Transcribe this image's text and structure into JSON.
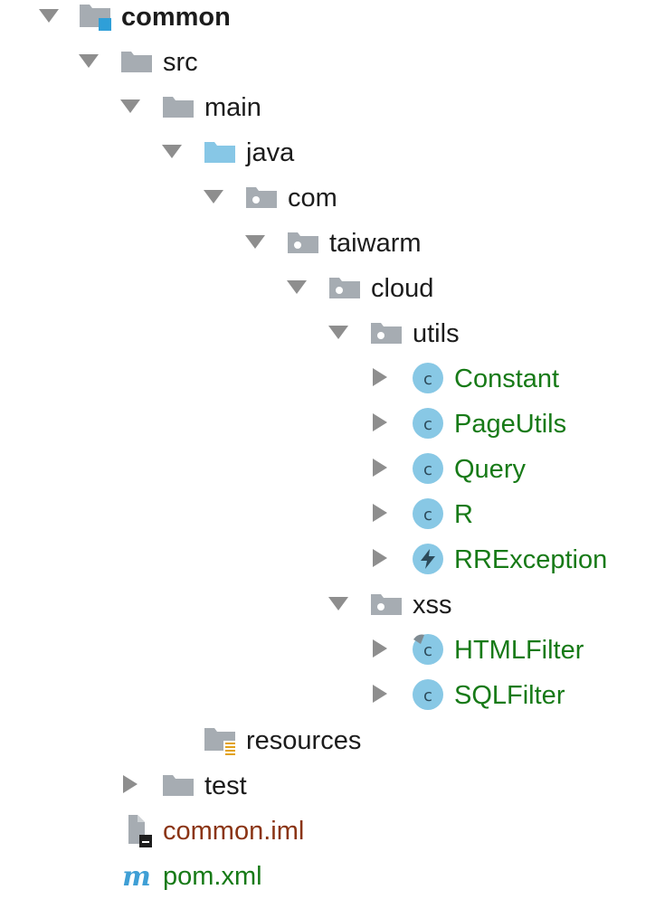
{
  "project_tree": {
    "root": {
      "label": "common",
      "icon": "module-folder-icon",
      "expanded": true
    },
    "nodes": [
      {
        "label": "src",
        "icon": "folder-icon",
        "expanded": true
      },
      {
        "label": "main",
        "icon": "folder-icon",
        "expanded": true
      },
      {
        "label": "java",
        "icon": "source-root-folder-icon",
        "expanded": true
      },
      {
        "label": "com",
        "icon": "package-icon",
        "expanded": true
      },
      {
        "label": "taiwarm",
        "icon": "package-icon",
        "expanded": true
      },
      {
        "label": "cloud",
        "icon": "package-icon",
        "expanded": true
      },
      {
        "label": "utils",
        "icon": "package-icon",
        "expanded": true
      },
      {
        "label": "Constant",
        "icon": "class-icon",
        "expanded": false
      },
      {
        "label": "PageUtils",
        "icon": "class-icon",
        "expanded": false
      },
      {
        "label": "Query",
        "icon": "class-icon",
        "expanded": false
      },
      {
        "label": "R",
        "icon": "class-icon",
        "expanded": false
      },
      {
        "label": "RRException",
        "icon": "exception-class-icon",
        "expanded": false
      },
      {
        "label": "xss",
        "icon": "package-icon",
        "expanded": true
      },
      {
        "label": "HTMLFilter",
        "icon": "class-icon",
        "expanded": false
      },
      {
        "label": "SQLFilter",
        "icon": "class-icon",
        "expanded": false
      },
      {
        "label": "resources",
        "icon": "resources-folder-icon"
      },
      {
        "label": "test",
        "icon": "folder-icon",
        "expanded": false
      },
      {
        "label": "common.iml",
        "icon": "iml-file-icon"
      },
      {
        "label": "pom.xml",
        "icon": "maven-icon"
      }
    ]
  },
  "colors": {
    "class_name": "#177a17",
    "unversioned_file": "#8a3414",
    "folder": "#a6acb2",
    "source_root": "#87c7e6",
    "class_badge": "#88c8e5",
    "arrow": "#8e8e8e"
  }
}
